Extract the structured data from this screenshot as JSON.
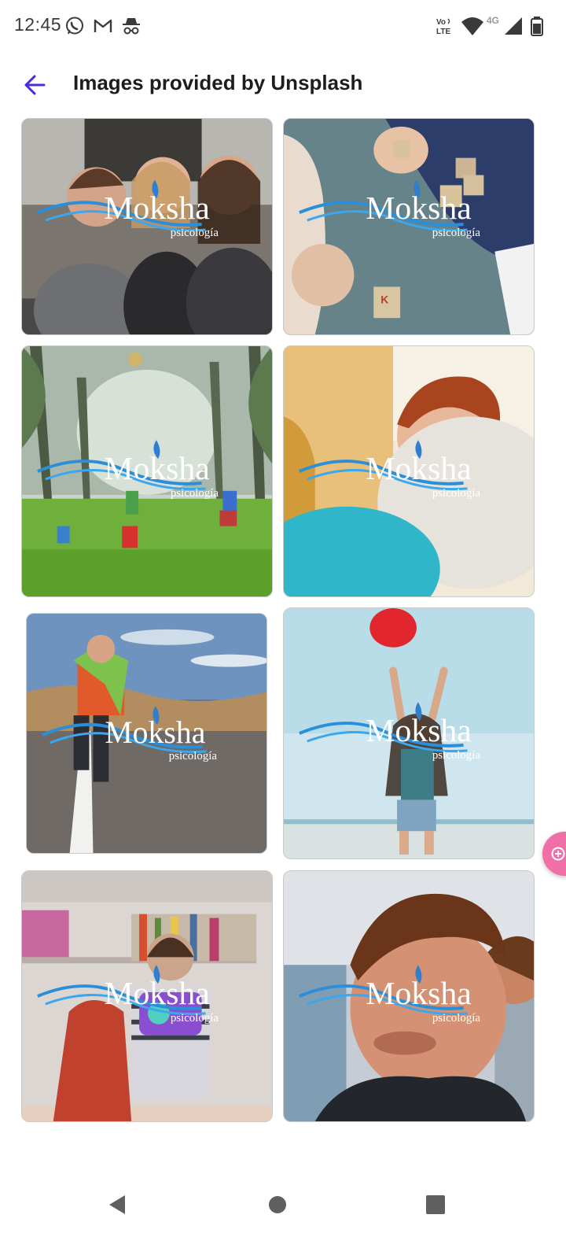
{
  "status_bar": {
    "time": "12:45",
    "left_icons": [
      "whatsapp-icon",
      "gmail-icon",
      "incognito-icon"
    ],
    "network_label": "VoLTE",
    "network_type": "4G",
    "right_icons": [
      "volte-icon",
      "wifi-icon",
      "cellular-signal-icon",
      "battery-icon"
    ]
  },
  "app_bar": {
    "title": "Images provided by Unsplash",
    "back_icon": "arrow-back-icon",
    "accent_color": "#4c2bd8"
  },
  "gallery": {
    "watermark": {
      "brand": "Moksha",
      "subtitle": "psicología"
    },
    "images": [
      {
        "id": "kids-laughing-on-bench",
        "description_icon": "photo"
      },
      {
        "id": "kids-alphabet-blocks",
        "description_icon": "photo"
      },
      {
        "id": "kids-jumping-in-park",
        "description_icon": "photo"
      },
      {
        "id": "child-with-balloons",
        "description_icon": "photo"
      },
      {
        "id": "boy-jumping-on-road",
        "description_icon": "photo"
      },
      {
        "id": "girl-red-balloon-beach",
        "description_icon": "photo"
      },
      {
        "id": "toddler-with-toy-camera",
        "description_icon": "photo"
      },
      {
        "id": "boy-making-funny-face",
        "description_icon": "photo"
      }
    ]
  },
  "floating_tab": {
    "icon": "plus-circle-icon",
    "color": "#f06fa6"
  },
  "nav_bar": {
    "icons": [
      "nav-back-icon",
      "nav-home-icon",
      "nav-recents-icon"
    ]
  }
}
